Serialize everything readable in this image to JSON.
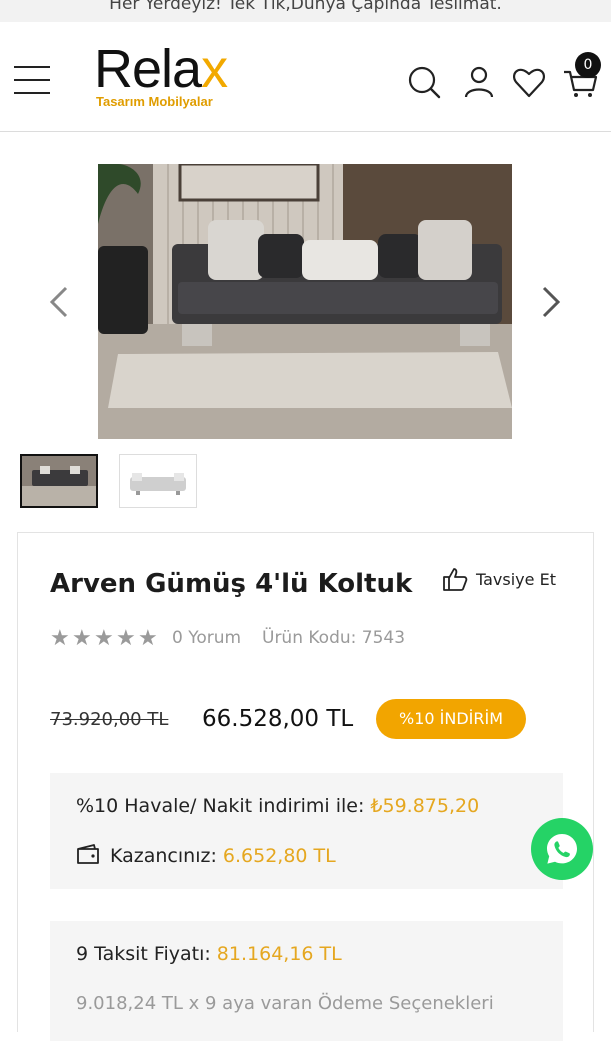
{
  "announcement": "Her Yerdeyiz! Tek Tık,Dünya Çapında Teslimat.",
  "brand": {
    "name": "Rela",
    "name_accent": "x",
    "tagline": "Tasarım Mobilyalar",
    "accent_color": "#f2a900"
  },
  "header": {
    "icons": [
      "menu-icon",
      "search-icon",
      "user-icon",
      "heart-icon",
      "cart-icon"
    ],
    "cart_count": "0"
  },
  "gallery": {
    "thumbnail_count": 2,
    "selected_thumbnail": 1
  },
  "product": {
    "title": "Arven Gümüş 4'lü Koltuk",
    "recommend_label": "Tavsiye Et",
    "rating_stars": 5,
    "reviews": "0 Yorum",
    "code": "Ürün Kodu: 7543",
    "old_price": "73.920,00 TL",
    "price": "66.528,00 TL",
    "discount_badge": "%10 İNDİRİM",
    "badge_color": "#f2a500"
  },
  "payment": {
    "transfer_label": "%10 Havale/ Nakit indirimi ile:",
    "transfer_value": "₺59.875,20",
    "savings_label": "Kazancınız:",
    "savings_value": "6.652,80 TL",
    "installment_label": "9 Taksit Fiyatı:",
    "installment_value": "81.164,16 TL",
    "installment_detail": "9.018,24 TL x 9 aya varan Ödeme Seçenekleri"
  }
}
